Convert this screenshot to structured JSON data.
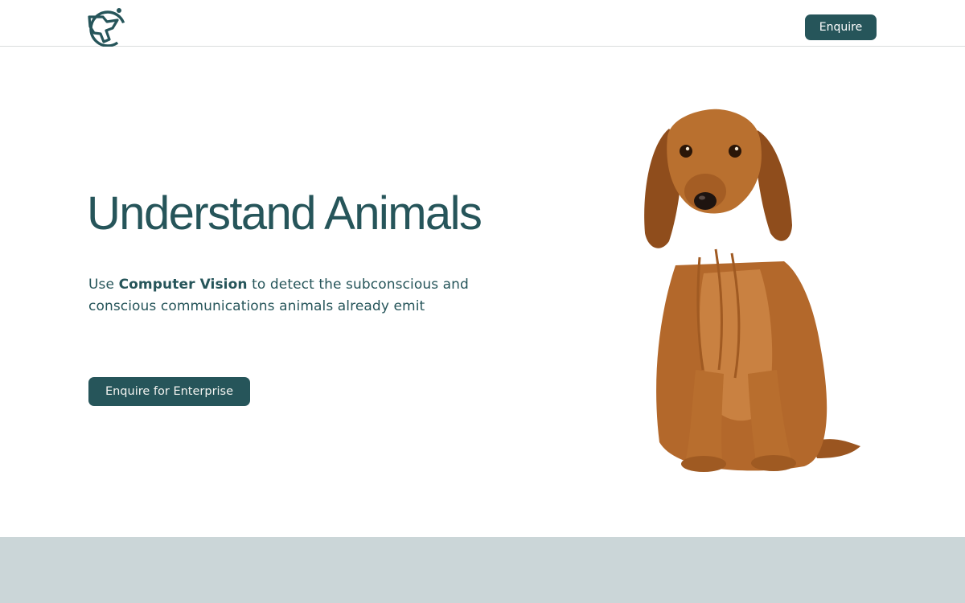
{
  "header": {
    "logo_icon": "dog-head-logo-icon",
    "enquire_label": "Enquire"
  },
  "hero": {
    "title": "Understand Animals",
    "subtitle_prefix": "Use ",
    "subtitle_emphasis": "Computer Vision",
    "subtitle_suffix": " to detect the subconscious and conscious communications animals already emit",
    "cta_label": "Enquire for Enterprise",
    "image_icon": "dachshund-photo"
  },
  "colors": {
    "brand": "#26555a",
    "background": "#ffffff",
    "bottom_band": "#cbd6d8",
    "dog_fur": "#b8692a"
  }
}
